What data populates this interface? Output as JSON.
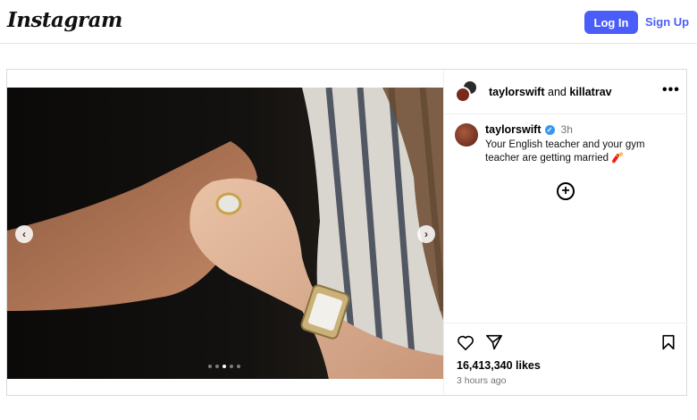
{
  "header": {
    "logo": "Instagram",
    "login_label": "Log In",
    "signup_label": "Sign Up",
    "accent_color": "#4a5df9"
  },
  "post": {
    "collaborators": {
      "user1": "taylorswift",
      "joiner": "and",
      "user2": "killatrav"
    },
    "more_icon": "more-horizontal-icon",
    "comment": {
      "username": "taylorswift",
      "verified": true,
      "time": "3h",
      "caption": "Your English teacher and your gym teacher are getting married 🧨"
    },
    "carousel": {
      "slide_count": 5,
      "active_index": 2
    },
    "likes": "16,413,340 likes",
    "posted": "3 hours ago",
    "icons": [
      "heart-icon",
      "share-icon",
      "bookmark-icon",
      "add-circle-icon"
    ]
  }
}
